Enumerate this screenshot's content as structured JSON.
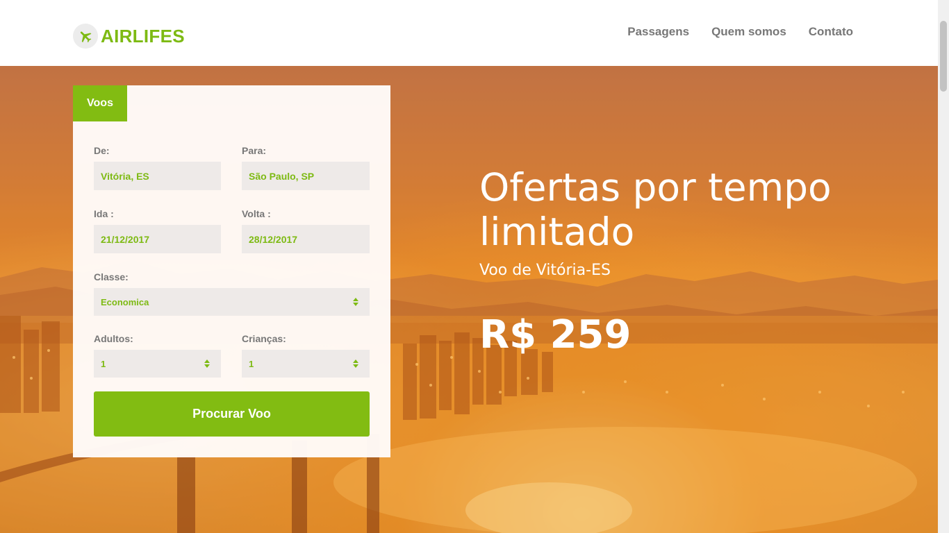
{
  "header": {
    "brand": "AIRLIFES",
    "nav": [
      "Passagens",
      "Quem somos",
      "Contato"
    ]
  },
  "search": {
    "tab": "Voos",
    "from": {
      "label": "De:",
      "value": "Vitória, ES"
    },
    "to": {
      "label": "Para:",
      "value": "São Paulo, SP"
    },
    "depart": {
      "label": "Ida :",
      "value": "21/12/2017"
    },
    "return": {
      "label": "Volta :",
      "value": "28/12/2017"
    },
    "class": {
      "label": "Classe:",
      "value": "Economica"
    },
    "adults": {
      "label": "Adultos:",
      "value": "1"
    },
    "children": {
      "label": "Crianças:",
      "value": "1"
    },
    "submit": "Procurar Voo"
  },
  "offer": {
    "title": "Ofertas por tempo limitado",
    "subtitle": "Voo de Vitória-ES",
    "price": "R$ 259"
  },
  "colors": {
    "accent": "#82bc12",
    "accent_text": "#7dba13",
    "nav_text": "#777777",
    "field_bg": "#eeeae8"
  },
  "icons": {
    "logo": "airplane-icon",
    "select": "sort-arrows-icon"
  }
}
